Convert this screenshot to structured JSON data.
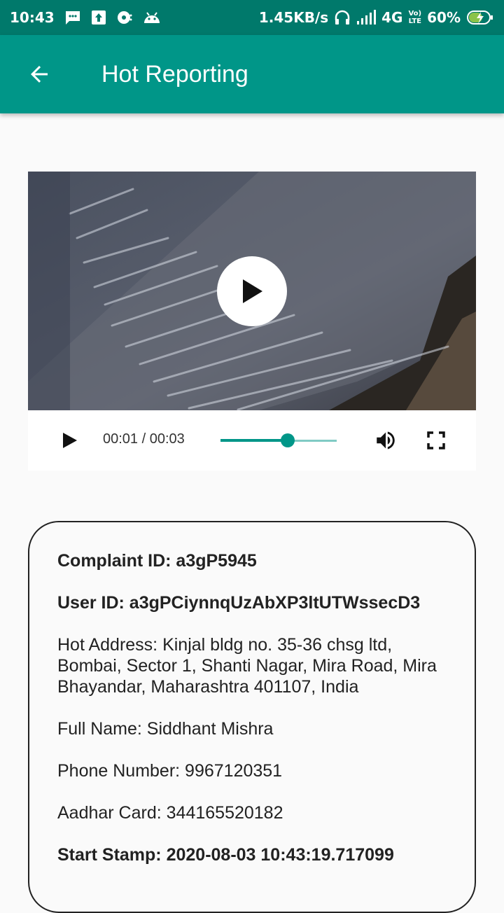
{
  "status_bar": {
    "time": "10:43",
    "speed": "1.45KB/s",
    "network": "4G",
    "volte_top": "Vo)",
    "volte_bottom": "LTE",
    "battery": "60%"
  },
  "app_bar": {
    "title": "Hot Reporting",
    "back_icon": "arrow-back-icon"
  },
  "video_player": {
    "current_time": "00:01",
    "separator": " / ",
    "duration": "00:03",
    "progress": 0.58,
    "big_play_icon": "play-icon",
    "play_icon": "play-icon",
    "volume_icon": "volume-icon",
    "fullscreen_icon": "fullscreen-icon"
  },
  "details": {
    "complaint_id": "Complaint ID: a3gP5945",
    "user_id": "User ID: a3gPCiynnqUzAbXP3ltUTWssecD3",
    "hot_address": "Hot Address: Kinjal bldg no. 35-36 chsg ltd, Bombai, Sector 1, Shanti Nagar, Mira Road, Mira Bhayandar, Maharashtra 401107, India",
    "full_name": "Full Name: Siddhant Mishra",
    "phone_number": "Phone Number: 9967120351",
    "aadhar_card": "Aadhar Card: 344165520182",
    "start_stamp": "Start Stamp: 2020-08-03 10:43:19.717099"
  },
  "colors": {
    "status_bar": "#00796b",
    "app_bar": "#009688",
    "accent": "#009688",
    "track": "#80cbc4"
  }
}
